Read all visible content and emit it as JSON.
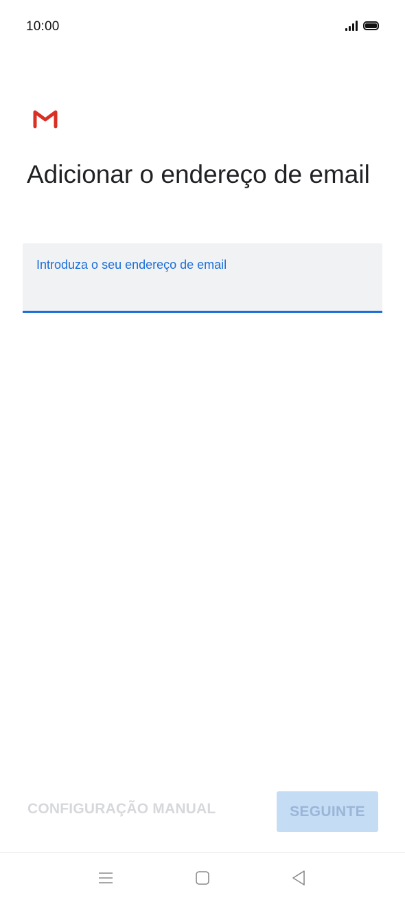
{
  "status_bar": {
    "time": "10:00",
    "signal_icon": "cellular-signal-icon",
    "battery_icon": "battery-full-icon"
  },
  "app": {
    "logo_icon": "gmail-logo-icon",
    "colors": {
      "accent": "#1a6ed8",
      "gmail_red": "#d93025",
      "next_button_bg": "#c5dcf5"
    }
  },
  "page": {
    "title": "Adicionar o endereço de email"
  },
  "email_field": {
    "label": "Introduza o seu endereço de email",
    "value": ""
  },
  "actions": {
    "manual_setup_label": "CONFIGURAÇÃO MANUAL",
    "next_label": "SEGUINTE"
  },
  "nav_bar": {
    "menu_icon": "menu-icon",
    "home_icon": "home-icon",
    "back_icon": "back-icon"
  }
}
